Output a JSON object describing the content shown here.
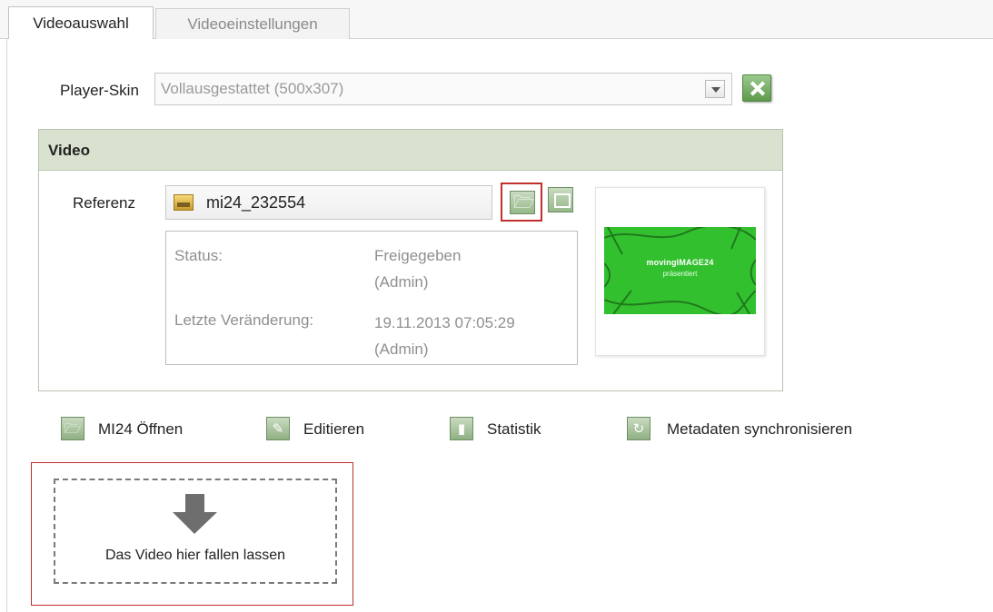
{
  "tabs": [
    {
      "label": "Videoauswahl",
      "active": true
    },
    {
      "label": "Videoeinstellungen",
      "active": false
    }
  ],
  "player_skin": {
    "label": "Player-Skin",
    "selected": "Vollausgestattet (500x307)"
  },
  "video": {
    "title": "Video",
    "reference_label": "Referenz",
    "reference_value": "mi24_232554",
    "status_key": "Status:",
    "status_value": "Freigegeben",
    "status_user": "(Admin)",
    "changed_key": "Letzte Veränderung:",
    "changed_value": "19.11.2013 07:05:29",
    "changed_user": "(Admin)",
    "thumbnail": {
      "brand": "movingIMAGE24",
      "subtitle": "präsentiert",
      "color": "#33c02f"
    }
  },
  "actions": [
    {
      "label": "MI24 Öffnen",
      "icon": "folder-open-icon"
    },
    {
      "label": "Editieren",
      "icon": "edit-icon"
    },
    {
      "label": "Statistik",
      "icon": "bar-chart-icon"
    },
    {
      "label": "Metadaten synchronisieren",
      "icon": "sync-icon"
    }
  ],
  "dropzone": {
    "text": "Das Video hier fallen lassen"
  },
  "colors": {
    "panel_header": "#d8e2cf",
    "highlight": "#c0302c",
    "button_green": "#8fb083"
  }
}
